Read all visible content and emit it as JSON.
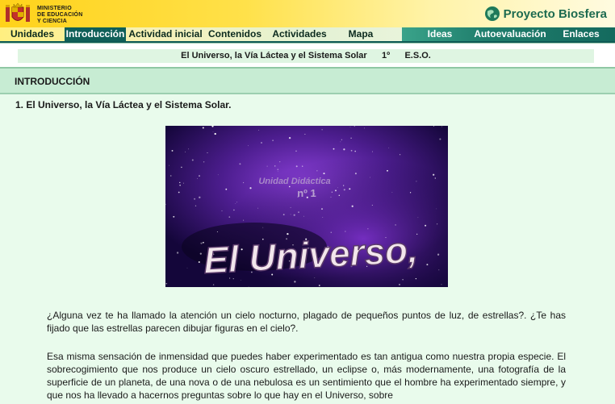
{
  "header": {
    "ministry_lines": [
      "MINISTERIO",
      "DE EDUCACIÓN",
      "Y CIENCIA"
    ],
    "brand": "Proyecto Biosfera",
    "crest_icon": "coat-of-arms-icon",
    "globe_icon": "globe-icon"
  },
  "menu": {
    "left": [
      "Unidades",
      "Introducción",
      "Actividad inicial",
      "Contenidos",
      "Actividades",
      "Mapa"
    ],
    "right": [
      "Ideas",
      "Autoevaluación",
      "Enlaces"
    ],
    "active": "Introducción"
  },
  "subject": {
    "title": "El Universo, la Vía Láctea y el Sistema Solar",
    "course": "1º",
    "level": "E.S.O."
  },
  "section": {
    "title": "INTRODUCCIÓN",
    "subtitle": "1. El Universo, la Vía Láctea y el Sistema Solar."
  },
  "image": {
    "line1": "Unidad Didáctica",
    "line2": "nº 1",
    "big": "El Universo,"
  },
  "paragraphs": [
    "¿Alguna vez te ha llamado la atención un cielo nocturno, plagado de pequeños puntos de luz, de estrellas?. ¿Te has fijado que las estrellas parecen dibujar figuras en el cielo?.",
    "Esa misma sensación de inmensidad que puedes haber experimentado es tan antigua como nuestra propia especie. El sobrecogimiento que nos produce un cielo oscuro estrellado, un eclipse o, más modernamente, una fotografía de la superficie de un planeta, de una nova o de una nebulosa es un sentimiento que el hombre ha experimentado siempre, y que nos ha llevado a hacernos preguntas sobre lo que hay en el Universo, sobre"
  ],
  "colors": {
    "banner_yellow": "#ffd21a",
    "menu_active": "#0f5f58",
    "content_bg": "#e9fbec",
    "header_bg": "#c7ecd3"
  }
}
